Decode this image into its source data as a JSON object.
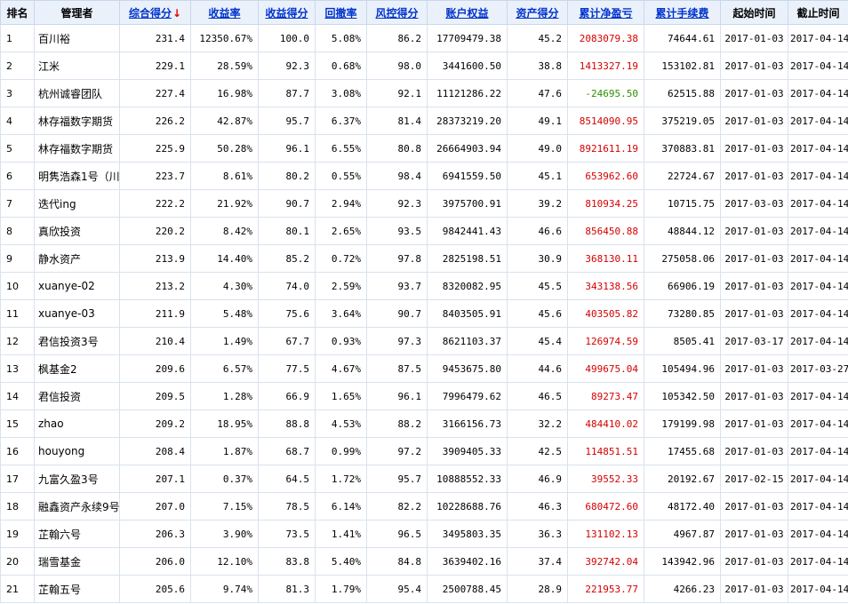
{
  "headers": {
    "rank": "排名",
    "manager": "管理者",
    "score": "综合得分",
    "score_arrow": "↓",
    "return_rate": "收益率",
    "return_score": "收益得分",
    "drawdown": "回撤率",
    "risk_score": "风控得分",
    "equity": "账户权益",
    "asset_score": "资产得分",
    "cum_profit": "累计净盈亏",
    "cum_fee": "累计手续费",
    "start": "起始时间",
    "end": "截止时间"
  },
  "colors": {
    "link": "#0033cc",
    "sort_arrow": "#e00000",
    "profit_positive": "#d40000",
    "profit_negative": "#2f8f00"
  },
  "rows": [
    {
      "rank": "1",
      "manager": "百川裕",
      "score": "231.4",
      "return_rate": "12350.67%",
      "return_score": "100.0",
      "drawdown": "5.08%",
      "risk_score": "86.2",
      "equity": "17709479.38",
      "asset_score": "45.2",
      "cum_profit": "2083079.38",
      "cum_fee": "74644.61",
      "start": "2017-01-03",
      "end": "2017-04-14"
    },
    {
      "rank": "2",
      "manager": "江米",
      "score": "229.1",
      "return_rate": "28.59%",
      "return_score": "92.3",
      "drawdown": "0.68%",
      "risk_score": "98.0",
      "equity": "3441600.50",
      "asset_score": "38.8",
      "cum_profit": "1413327.19",
      "cum_fee": "153102.81",
      "start": "2017-01-03",
      "end": "2017-04-14"
    },
    {
      "rank": "3",
      "manager": "杭州诚睿团队",
      "score": "227.4",
      "return_rate": "16.98%",
      "return_score": "87.7",
      "drawdown": "3.08%",
      "risk_score": "92.1",
      "equity": "11121286.22",
      "asset_score": "47.6",
      "cum_profit": "-24695.50",
      "cum_fee": "62515.88",
      "start": "2017-01-03",
      "end": "2017-04-14"
    },
    {
      "rank": "4",
      "manager": "林存福数字期货",
      "score": "226.2",
      "return_rate": "42.87%",
      "return_score": "95.7",
      "drawdown": "6.37%",
      "risk_score": "81.4",
      "equity": "28373219.20",
      "asset_score": "49.1",
      "cum_profit": "8514090.95",
      "cum_fee": "375219.05",
      "start": "2017-01-03",
      "end": "2017-04-14"
    },
    {
      "rank": "5",
      "manager": "林存福数字期货",
      "score": "225.9",
      "return_rate": "50.28%",
      "return_score": "96.1",
      "drawdown": "6.55%",
      "risk_score": "80.8",
      "equity": "26664903.94",
      "asset_score": "49.0",
      "cum_profit": "8921611.19",
      "cum_fee": "370883.81",
      "start": "2017-01-03",
      "end": "2017-04-14"
    },
    {
      "rank": "6",
      "manager": "明隽浩森1号（川",
      "score": "223.7",
      "return_rate": "8.61%",
      "return_score": "80.2",
      "drawdown": "0.55%",
      "risk_score": "98.4",
      "equity": "6941559.50",
      "asset_score": "45.1",
      "cum_profit": "653962.60",
      "cum_fee": "22724.67",
      "start": "2017-01-03",
      "end": "2017-04-14"
    },
    {
      "rank": "7",
      "manager": "迭代ing",
      "score": "222.2",
      "return_rate": "21.92%",
      "return_score": "90.7",
      "drawdown": "2.94%",
      "risk_score": "92.3",
      "equity": "3975700.91",
      "asset_score": "39.2",
      "cum_profit": "810934.25",
      "cum_fee": "10715.75",
      "start": "2017-03-03",
      "end": "2017-04-14"
    },
    {
      "rank": "8",
      "manager": "真欣投资",
      "score": "220.2",
      "return_rate": "8.42%",
      "return_score": "80.1",
      "drawdown": "2.65%",
      "risk_score": "93.5",
      "equity": "9842441.43",
      "asset_score": "46.6",
      "cum_profit": "856450.88",
      "cum_fee": "48844.12",
      "start": "2017-01-03",
      "end": "2017-04-14"
    },
    {
      "rank": "9",
      "manager": "静水资产",
      "score": "213.9",
      "return_rate": "14.40%",
      "return_score": "85.2",
      "drawdown": "0.72%",
      "risk_score": "97.8",
      "equity": "2825198.51",
      "asset_score": "30.9",
      "cum_profit": "368130.11",
      "cum_fee": "275058.06",
      "start": "2017-01-03",
      "end": "2017-04-14"
    },
    {
      "rank": "10",
      "manager": "xuanye-02",
      "score": "213.2",
      "return_rate": "4.30%",
      "return_score": "74.0",
      "drawdown": "2.59%",
      "risk_score": "93.7",
      "equity": "8320082.95",
      "asset_score": "45.5",
      "cum_profit": "343138.56",
      "cum_fee": "66906.19",
      "start": "2017-01-03",
      "end": "2017-04-14"
    },
    {
      "rank": "11",
      "manager": "xuanye-03",
      "score": "211.9",
      "return_rate": "5.48%",
      "return_score": "75.6",
      "drawdown": "3.64%",
      "risk_score": "90.7",
      "equity": "8403505.91",
      "asset_score": "45.6",
      "cum_profit": "403505.82",
      "cum_fee": "73280.85",
      "start": "2017-01-03",
      "end": "2017-04-14"
    },
    {
      "rank": "12",
      "manager": "君信投资3号",
      "score": "210.4",
      "return_rate": "1.49%",
      "return_score": "67.7",
      "drawdown": "0.93%",
      "risk_score": "97.3",
      "equity": "8621103.37",
      "asset_score": "45.4",
      "cum_profit": "126974.59",
      "cum_fee": "8505.41",
      "start": "2017-03-17",
      "end": "2017-04-14"
    },
    {
      "rank": "13",
      "manager": "枫基金2",
      "score": "209.6",
      "return_rate": "6.57%",
      "return_score": "77.5",
      "drawdown": "4.67%",
      "risk_score": "87.5",
      "equity": "9453675.80",
      "asset_score": "44.6",
      "cum_profit": "499675.04",
      "cum_fee": "105494.96",
      "start": "2017-01-03",
      "end": "2017-03-27"
    },
    {
      "rank": "14",
      "manager": "君信投资",
      "score": "209.5",
      "return_rate": "1.28%",
      "return_score": "66.9",
      "drawdown": "1.65%",
      "risk_score": "96.1",
      "equity": "7996479.62",
      "asset_score": "46.5",
      "cum_profit": "89273.47",
      "cum_fee": "105342.50",
      "start": "2017-01-03",
      "end": "2017-04-14"
    },
    {
      "rank": "15",
      "manager": "zhao",
      "score": "209.2",
      "return_rate": "18.95%",
      "return_score": "88.8",
      "drawdown": "4.53%",
      "risk_score": "88.2",
      "equity": "3166156.73",
      "asset_score": "32.2",
      "cum_profit": "484410.02",
      "cum_fee": "179199.98",
      "start": "2017-01-03",
      "end": "2017-04-14"
    },
    {
      "rank": "16",
      "manager": "houyong",
      "score": "208.4",
      "return_rate": "1.87%",
      "return_score": "68.7",
      "drawdown": "0.99%",
      "risk_score": "97.2",
      "equity": "3909405.33",
      "asset_score": "42.5",
      "cum_profit": "114851.51",
      "cum_fee": "17455.68",
      "start": "2017-01-03",
      "end": "2017-04-14"
    },
    {
      "rank": "17",
      "manager": "九富久盈3号",
      "score": "207.1",
      "return_rate": "0.37%",
      "return_score": "64.5",
      "drawdown": "1.72%",
      "risk_score": "95.7",
      "equity": "10888552.33",
      "asset_score": "46.9",
      "cum_profit": "39552.33",
      "cum_fee": "20192.67",
      "start": "2017-02-15",
      "end": "2017-04-14"
    },
    {
      "rank": "18",
      "manager": "融鑫资产永续9号",
      "score": "207.0",
      "return_rate": "7.15%",
      "return_score": "78.5",
      "drawdown": "6.14%",
      "risk_score": "82.2",
      "equity": "10228688.76",
      "asset_score": "46.3",
      "cum_profit": "680472.60",
      "cum_fee": "48172.40",
      "start": "2017-01-03",
      "end": "2017-04-14"
    },
    {
      "rank": "19",
      "manager": "芷翰六号",
      "score": "206.3",
      "return_rate": "3.90%",
      "return_score": "73.5",
      "drawdown": "1.41%",
      "risk_score": "96.5",
      "equity": "3495803.35",
      "asset_score": "36.3",
      "cum_profit": "131102.13",
      "cum_fee": "4967.87",
      "start": "2017-01-03",
      "end": "2017-04-14"
    },
    {
      "rank": "20",
      "manager": "瑞雪基金",
      "score": "206.0",
      "return_rate": "12.10%",
      "return_score": "83.8",
      "drawdown": "5.40%",
      "risk_score": "84.8",
      "equity": "3639402.16",
      "asset_score": "37.4",
      "cum_profit": "392742.04",
      "cum_fee": "143942.96",
      "start": "2017-01-03",
      "end": "2017-04-14"
    },
    {
      "rank": "21",
      "manager": "芷翰五号",
      "score": "205.6",
      "return_rate": "9.74%",
      "return_score": "81.3",
      "drawdown": "1.79%",
      "risk_score": "95.4",
      "equity": "2500788.45",
      "asset_score": "28.9",
      "cum_profit": "221953.77",
      "cum_fee": "4266.23",
      "start": "2017-01-03",
      "end": "2017-04-14"
    }
  ]
}
